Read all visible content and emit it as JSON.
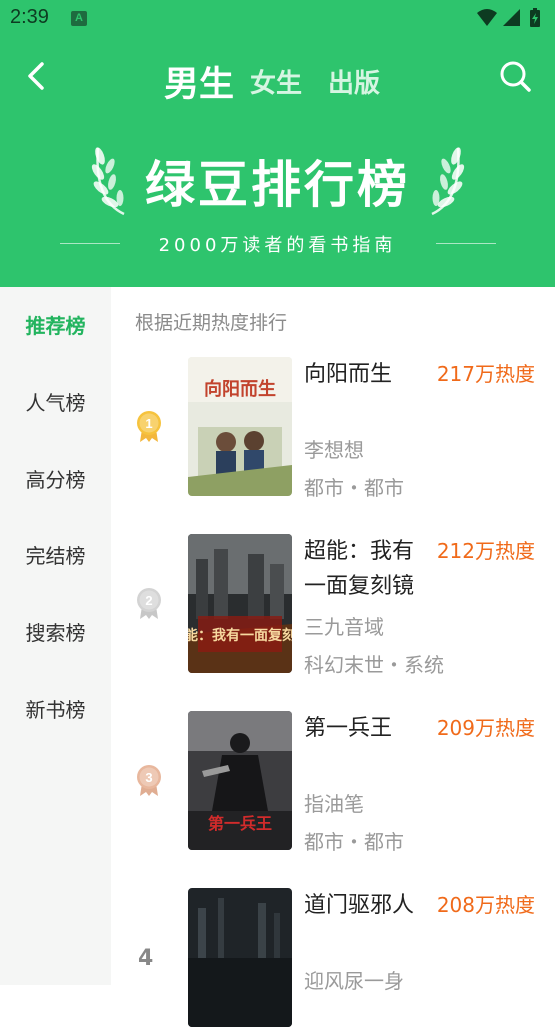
{
  "status_bar": {
    "time": "2:39",
    "notification_letter": "A"
  },
  "header": {
    "tabs": [
      "男生",
      "女生",
      "出版"
    ],
    "banner_title": "绿豆排行榜",
    "banner_subtitle": "2000万读者的看书指南",
    "bg_color": "#2ec46d"
  },
  "sidebar": {
    "items": [
      "推荐榜",
      "人气榜",
      "高分榜",
      "完结榜",
      "搜索榜",
      "新书榜"
    ],
    "active_index": 0
  },
  "list": {
    "hint": "根据近期热度排行",
    "books": [
      {
        "rank": "1",
        "title": "向阳而生",
        "heat": "217万热度",
        "author": "李想想",
        "tags": "都市・都市"
      },
      {
        "rank": "2",
        "title": "超能：我有一面复刻镜",
        "heat": "212万热度",
        "author": "三九音域",
        "tags": "科幻末世・系统"
      },
      {
        "rank": "3",
        "title": "第一兵王",
        "heat": "209万热度",
        "author": "指油笔",
        "tags": "都市・都市"
      },
      {
        "rank": "4",
        "title": "道门驱邪人",
        "heat": "208万热度",
        "author": "迎风尿一身",
        "tags": ""
      }
    ]
  }
}
